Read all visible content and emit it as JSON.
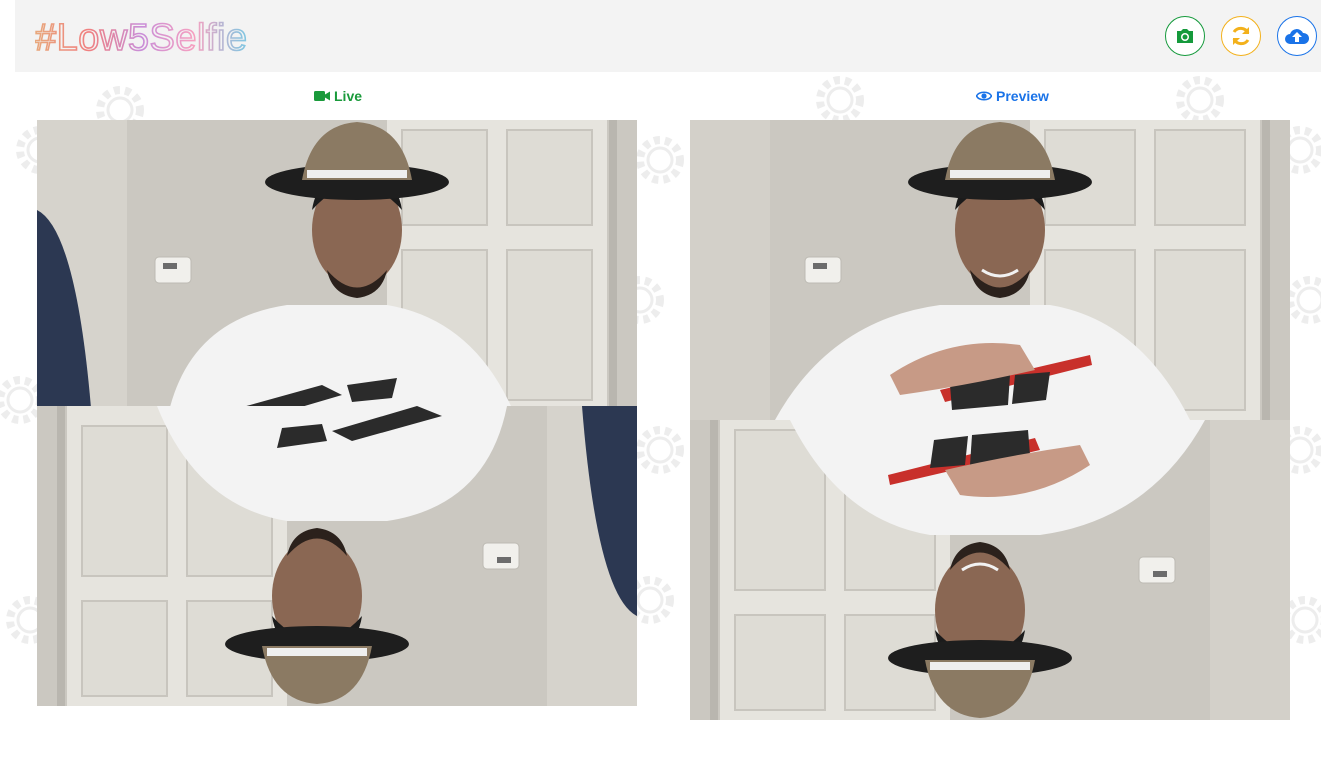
{
  "header": {
    "logo_text": "#Low5Selfie",
    "buttons": [
      {
        "name": "capture",
        "icon": "camera-icon",
        "color": "#159a3c"
      },
      {
        "name": "refresh",
        "icon": "refresh-icon",
        "color": "#f3b11b"
      },
      {
        "name": "upload",
        "icon": "cloud-upload-icon",
        "color": "#1a73e8"
      }
    ]
  },
  "live": {
    "label": "Live",
    "icon": "video-camera-icon",
    "color": "#1a9a3b"
  },
  "preview": {
    "label": "Preview",
    "icon": "eye-icon",
    "color": "#1a73e8"
  },
  "colors": {
    "header_bg": "#f3f3f3",
    "wall": "#c9c6bf",
    "door": "#e4e2dc",
    "shirt": "#f2f2f2"
  }
}
